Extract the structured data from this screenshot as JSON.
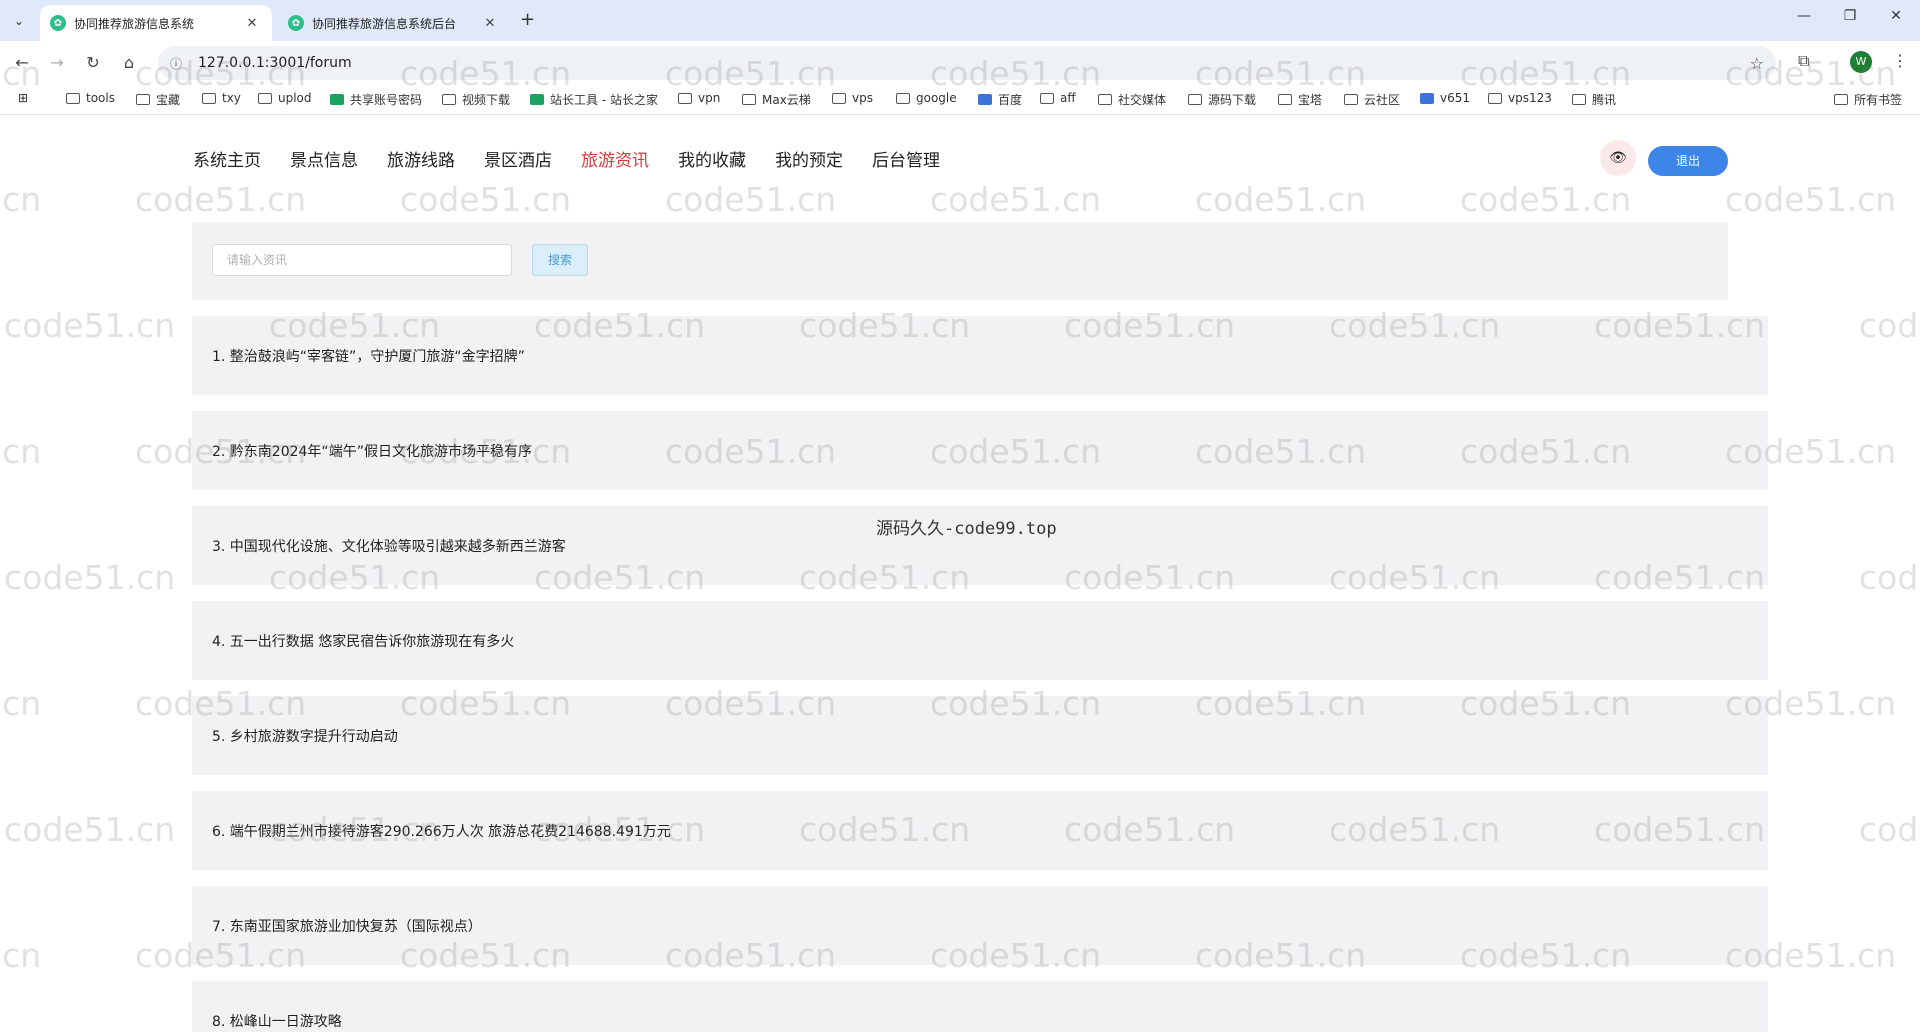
{
  "browser": {
    "tabs": [
      {
        "title": "协同推荐旅游信息系统",
        "active": true
      },
      {
        "title": "协同推荐旅游信息系统后台",
        "active": false
      }
    ],
    "url": "127.0.0.1:3001/forum",
    "profile_initial": "W",
    "bookmarks": [
      "tools",
      "宝藏",
      "txy",
      "uplod",
      "共享账号密码",
      "视频下载",
      "站长工具 - 站长之家",
      "vpn",
      "Max云梯",
      "vps",
      "google",
      "百度",
      "aff",
      "社交媒体",
      "源码下载",
      "宝塔",
      "云社区",
      "v651",
      "vps123",
      "腾讯"
    ],
    "bookmarks_right": "所有书签"
  },
  "nav": {
    "items": [
      "系统主页",
      "景点信息",
      "旅游线路",
      "景区酒店",
      "旅游资讯",
      "我的收藏",
      "我的预定",
      "后台管理"
    ],
    "active_index": 4,
    "logout_label": "退出"
  },
  "search": {
    "placeholder": "请输入资讯",
    "button_label": "搜索"
  },
  "news": [
    "1. 整治鼓浪屿“宰客链”，守护厦门旅游“金字招牌”",
    "2. 黔东南2024年“端午”假日文化旅游市场平稳有序",
    "3. 中国现代化设施、文化体验等吸引越来越多新西兰游客",
    "4. 五一出行数据 悠家民宿告诉你旅游现在有多火",
    "5. 乡村旅游数字提升行动启动",
    "6. 端午假期兰州市接待游客290.266万人次 旅游总花费214688.491万元",
    "7. 东南亚国家旅游业加快复苏（国际视点）",
    "8. 松峰山一日游攻略"
  ],
  "overlay_text": "源码久久-code99.top",
  "watermark_text": "code51.cn",
  "colors": {
    "accent": "#3d85e6",
    "active_nav": "#d63b3b",
    "panel_bg": "#f2f2f5"
  }
}
